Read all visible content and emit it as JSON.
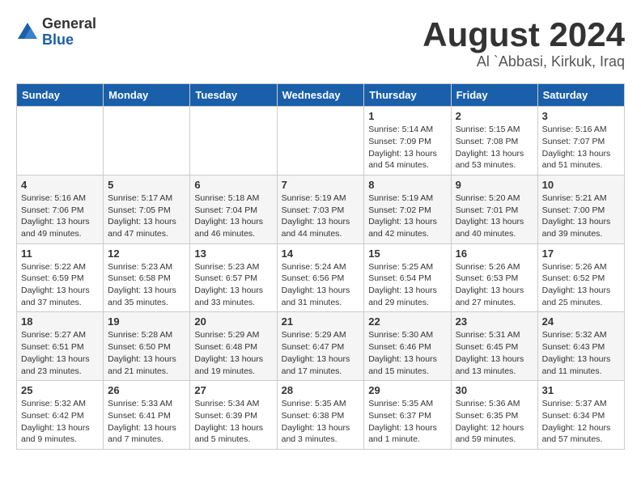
{
  "header": {
    "logo_general": "General",
    "logo_blue": "Blue",
    "month_title": "August 2024",
    "location": "Al `Abbasi, Kirkuk, Iraq"
  },
  "days_of_week": [
    "Sunday",
    "Monday",
    "Tuesday",
    "Wednesday",
    "Thursday",
    "Friday",
    "Saturday"
  ],
  "weeks": [
    [
      {
        "day": "",
        "info": ""
      },
      {
        "day": "",
        "info": ""
      },
      {
        "day": "",
        "info": ""
      },
      {
        "day": "",
        "info": ""
      },
      {
        "day": "1",
        "info": "Sunrise: 5:14 AM\nSunset: 7:09 PM\nDaylight: 13 hours\nand 54 minutes."
      },
      {
        "day": "2",
        "info": "Sunrise: 5:15 AM\nSunset: 7:08 PM\nDaylight: 13 hours\nand 53 minutes."
      },
      {
        "day": "3",
        "info": "Sunrise: 5:16 AM\nSunset: 7:07 PM\nDaylight: 13 hours\nand 51 minutes."
      }
    ],
    [
      {
        "day": "4",
        "info": "Sunrise: 5:16 AM\nSunset: 7:06 PM\nDaylight: 13 hours\nand 49 minutes."
      },
      {
        "day": "5",
        "info": "Sunrise: 5:17 AM\nSunset: 7:05 PM\nDaylight: 13 hours\nand 47 minutes."
      },
      {
        "day": "6",
        "info": "Sunrise: 5:18 AM\nSunset: 7:04 PM\nDaylight: 13 hours\nand 46 minutes."
      },
      {
        "day": "7",
        "info": "Sunrise: 5:19 AM\nSunset: 7:03 PM\nDaylight: 13 hours\nand 44 minutes."
      },
      {
        "day": "8",
        "info": "Sunrise: 5:19 AM\nSunset: 7:02 PM\nDaylight: 13 hours\nand 42 minutes."
      },
      {
        "day": "9",
        "info": "Sunrise: 5:20 AM\nSunset: 7:01 PM\nDaylight: 13 hours\nand 40 minutes."
      },
      {
        "day": "10",
        "info": "Sunrise: 5:21 AM\nSunset: 7:00 PM\nDaylight: 13 hours\nand 39 minutes."
      }
    ],
    [
      {
        "day": "11",
        "info": "Sunrise: 5:22 AM\nSunset: 6:59 PM\nDaylight: 13 hours\nand 37 minutes."
      },
      {
        "day": "12",
        "info": "Sunrise: 5:23 AM\nSunset: 6:58 PM\nDaylight: 13 hours\nand 35 minutes."
      },
      {
        "day": "13",
        "info": "Sunrise: 5:23 AM\nSunset: 6:57 PM\nDaylight: 13 hours\nand 33 minutes."
      },
      {
        "day": "14",
        "info": "Sunrise: 5:24 AM\nSunset: 6:56 PM\nDaylight: 13 hours\nand 31 minutes."
      },
      {
        "day": "15",
        "info": "Sunrise: 5:25 AM\nSunset: 6:54 PM\nDaylight: 13 hours\nand 29 minutes."
      },
      {
        "day": "16",
        "info": "Sunrise: 5:26 AM\nSunset: 6:53 PM\nDaylight: 13 hours\nand 27 minutes."
      },
      {
        "day": "17",
        "info": "Sunrise: 5:26 AM\nSunset: 6:52 PM\nDaylight: 13 hours\nand 25 minutes."
      }
    ],
    [
      {
        "day": "18",
        "info": "Sunrise: 5:27 AM\nSunset: 6:51 PM\nDaylight: 13 hours\nand 23 minutes."
      },
      {
        "day": "19",
        "info": "Sunrise: 5:28 AM\nSunset: 6:50 PM\nDaylight: 13 hours\nand 21 minutes."
      },
      {
        "day": "20",
        "info": "Sunrise: 5:29 AM\nSunset: 6:48 PM\nDaylight: 13 hours\nand 19 minutes."
      },
      {
        "day": "21",
        "info": "Sunrise: 5:29 AM\nSunset: 6:47 PM\nDaylight: 13 hours\nand 17 minutes."
      },
      {
        "day": "22",
        "info": "Sunrise: 5:30 AM\nSunset: 6:46 PM\nDaylight: 13 hours\nand 15 minutes."
      },
      {
        "day": "23",
        "info": "Sunrise: 5:31 AM\nSunset: 6:45 PM\nDaylight: 13 hours\nand 13 minutes."
      },
      {
        "day": "24",
        "info": "Sunrise: 5:32 AM\nSunset: 6:43 PM\nDaylight: 13 hours\nand 11 minutes."
      }
    ],
    [
      {
        "day": "25",
        "info": "Sunrise: 5:32 AM\nSunset: 6:42 PM\nDaylight: 13 hours\nand 9 minutes."
      },
      {
        "day": "26",
        "info": "Sunrise: 5:33 AM\nSunset: 6:41 PM\nDaylight: 13 hours\nand 7 minutes."
      },
      {
        "day": "27",
        "info": "Sunrise: 5:34 AM\nSunset: 6:39 PM\nDaylight: 13 hours\nand 5 minutes."
      },
      {
        "day": "28",
        "info": "Sunrise: 5:35 AM\nSunset: 6:38 PM\nDaylight: 13 hours\nand 3 minutes."
      },
      {
        "day": "29",
        "info": "Sunrise: 5:35 AM\nSunset: 6:37 PM\nDaylight: 13 hours\nand 1 minute."
      },
      {
        "day": "30",
        "info": "Sunrise: 5:36 AM\nSunset: 6:35 PM\nDaylight: 12 hours\nand 59 minutes."
      },
      {
        "day": "31",
        "info": "Sunrise: 5:37 AM\nSunset: 6:34 PM\nDaylight: 12 hours\nand 57 minutes."
      }
    ]
  ]
}
